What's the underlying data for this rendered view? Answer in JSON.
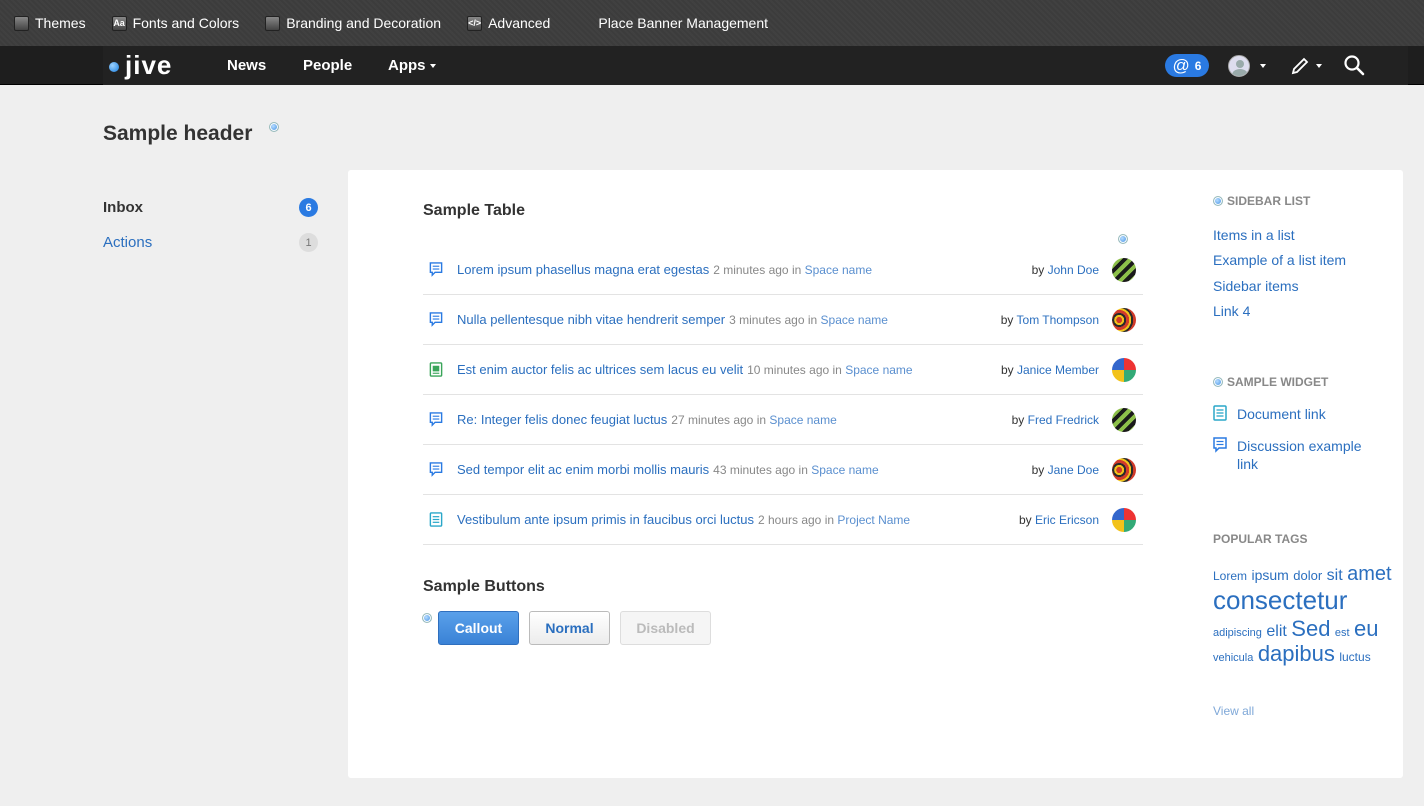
{
  "admin_bar": {
    "items": [
      {
        "label": "Themes",
        "icon": "themes-icon"
      },
      {
        "label": "Fonts and Colors",
        "icon": "fonts-icon",
        "glyph": "Aa"
      },
      {
        "label": "Branding and Decoration",
        "icon": "branding-icon"
      },
      {
        "label": "Advanced",
        "icon": "advanced-icon",
        "glyph": "</>"
      },
      {
        "label": "Place Banner Management",
        "icon": ""
      }
    ]
  },
  "navbar": {
    "logo_text": "jive",
    "links": [
      "News",
      "People",
      "Apps"
    ],
    "mention_count": "6"
  },
  "page": {
    "title": "Sample header"
  },
  "left_nav": [
    {
      "label": "Inbox",
      "count": "6"
    },
    {
      "label": "Actions",
      "count": "1"
    }
  ],
  "table": {
    "title": "Sample Table",
    "rows": [
      {
        "title": "Lorem ipsum phasellus magna erat egestas",
        "time": "2 minutes ago",
        "in": "in",
        "space": "Space name",
        "by": "by",
        "author": "John Doe",
        "icon": "discussion-icon"
      },
      {
        "title": "Nulla pellentesque nibh vitae hendrerit semper",
        "time": "3 minutes ago",
        "in": "in",
        "space": "Space name",
        "by": "by",
        "author": "Tom Thompson",
        "icon": "discussion-icon"
      },
      {
        "title": "Est enim auctor felis ac ultrices sem lacus eu velit",
        "time": "10 minutes ago",
        "in": "in",
        "space": "Space name",
        "by": "by",
        "author": "Janice Member",
        "icon": "image-document-icon"
      },
      {
        "title": "Re: Integer felis donec feugiat luctus",
        "time": "27 minutes ago",
        "in": "in",
        "space": "Space name",
        "by": "by",
        "author": "Fred Fredrick",
        "icon": "discussion-icon"
      },
      {
        "title": "Sed tempor elit ac enim morbi mollis mauris",
        "time": "43 minutes ago",
        "in": "in",
        "space": "Space name",
        "by": "by",
        "author": "Jane Doe",
        "icon": "discussion-icon"
      },
      {
        "title": "Vestibulum ante ipsum primis in faucibus orci luctus",
        "time": "2 hours ago",
        "in": "in",
        "space": "Project Name",
        "by": "by",
        "author": "Eric Ericson",
        "icon": "document-icon"
      }
    ]
  },
  "buttons": {
    "title": "Sample Buttons",
    "callout": "Callout",
    "normal": "Normal",
    "disabled": "Disabled"
  },
  "sidebar": {
    "list_title": "SIDEBAR LIST",
    "list_items": [
      "Items in a list",
      "Example of a list item",
      "Sidebar items",
      "Link 4"
    ],
    "widget_title": "SAMPLE WIDGET",
    "widget_items": [
      {
        "label": "Document link",
        "icon": "document-icon"
      },
      {
        "label": "Discussion example link",
        "icon": "discussion-icon"
      }
    ],
    "tags_title": "POPULAR TAGS",
    "tags": [
      "Lorem",
      "ipsum",
      "dolor",
      "sit",
      "amet",
      "consectetur",
      "adipiscing",
      "elit",
      "Sed",
      "est",
      "eu",
      "vehicula",
      "dapibus",
      "luctus"
    ],
    "view_all": "View all"
  },
  "colors": {
    "accent": "#2a7ae2",
    "link": "#2b6fbf",
    "admin_bar": "#3c3c3c",
    "navbar": "#222222"
  }
}
